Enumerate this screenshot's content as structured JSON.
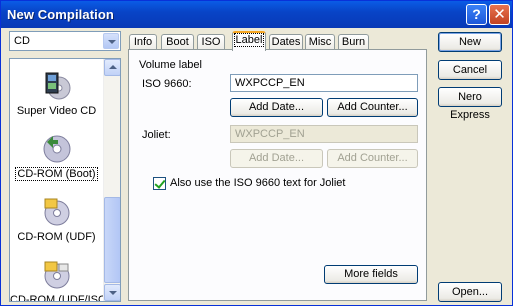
{
  "window": {
    "title": "New Compilation",
    "help_icon": "?",
    "close_icon": "✕"
  },
  "type_combo": {
    "value": "CD"
  },
  "compilation_types": [
    {
      "label": "Super Video CD",
      "icon": "film-disc-icon",
      "selected": false
    },
    {
      "label": "CD-ROM (Boot)",
      "icon": "boot-disc-icon",
      "selected": true
    },
    {
      "label": "CD-ROM (UDF)",
      "icon": "udf-disc-icon",
      "selected": false
    },
    {
      "label": "CD-ROM (UDF/ISO)",
      "icon": "udf-iso-disc-icon",
      "selected": false
    }
  ],
  "tabs": [
    "Info",
    "Boot",
    "ISO",
    "Label",
    "Dates",
    "Misc",
    "Burn"
  ],
  "active_tab": "Label",
  "label_panel": {
    "section_title": "Volume label",
    "iso_label": "ISO 9660:",
    "iso_value": "WXPCCP_EN",
    "add_date": "Add Date...",
    "add_counter": "Add Counter...",
    "joliet_label": "Joliet:",
    "joliet_value": "WXPCCP_EN",
    "joliet_add_date": "Add Date...",
    "joliet_add_counter": "Add Counter...",
    "checkbox_label": "Also use the ISO 9660 text for Joliet",
    "checkbox_checked": true,
    "more_fields": "More fields"
  },
  "right_buttons": {
    "new": "New",
    "cancel": "Cancel",
    "nero_express": "Nero Express",
    "open": "Open..."
  },
  "colors": {
    "title_bar": "#0a5ce6",
    "tab_highlight": "#f5a623",
    "dialog_bg": "#ece9d8"
  }
}
